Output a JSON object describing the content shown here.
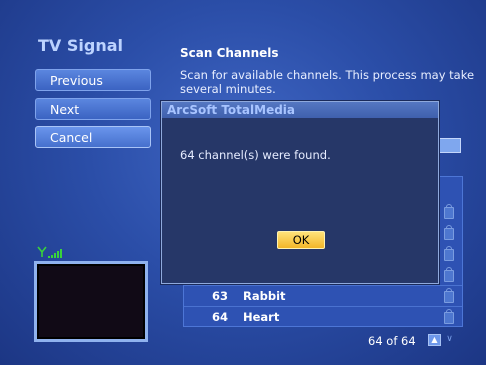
{
  "page": {
    "title": "TV Signal"
  },
  "nav": {
    "previous_label": "Previous",
    "next_label": "Next",
    "cancel_label": "Cancel"
  },
  "content": {
    "heading": "Scan Channels",
    "description": "Scan for available channels. This process may take several minutes."
  },
  "channels": [
    {
      "number": "63",
      "name": "Rabbit"
    },
    {
      "number": "64",
      "name": "Heart"
    }
  ],
  "pager": {
    "text": "64 of 64"
  },
  "dialog": {
    "title": "ArcSoft TotalMedia",
    "message": "64 channel(s) were found.",
    "ok_label": "OK"
  },
  "colors": {
    "background": "#2b4ea8",
    "accent": "#f2b628",
    "signal": "#39d23b"
  },
  "icons": {
    "signal": "signal-strength-icon",
    "lock": "lock-icon",
    "up": "scroll-up-icon",
    "down": "scroll-down-icon"
  }
}
